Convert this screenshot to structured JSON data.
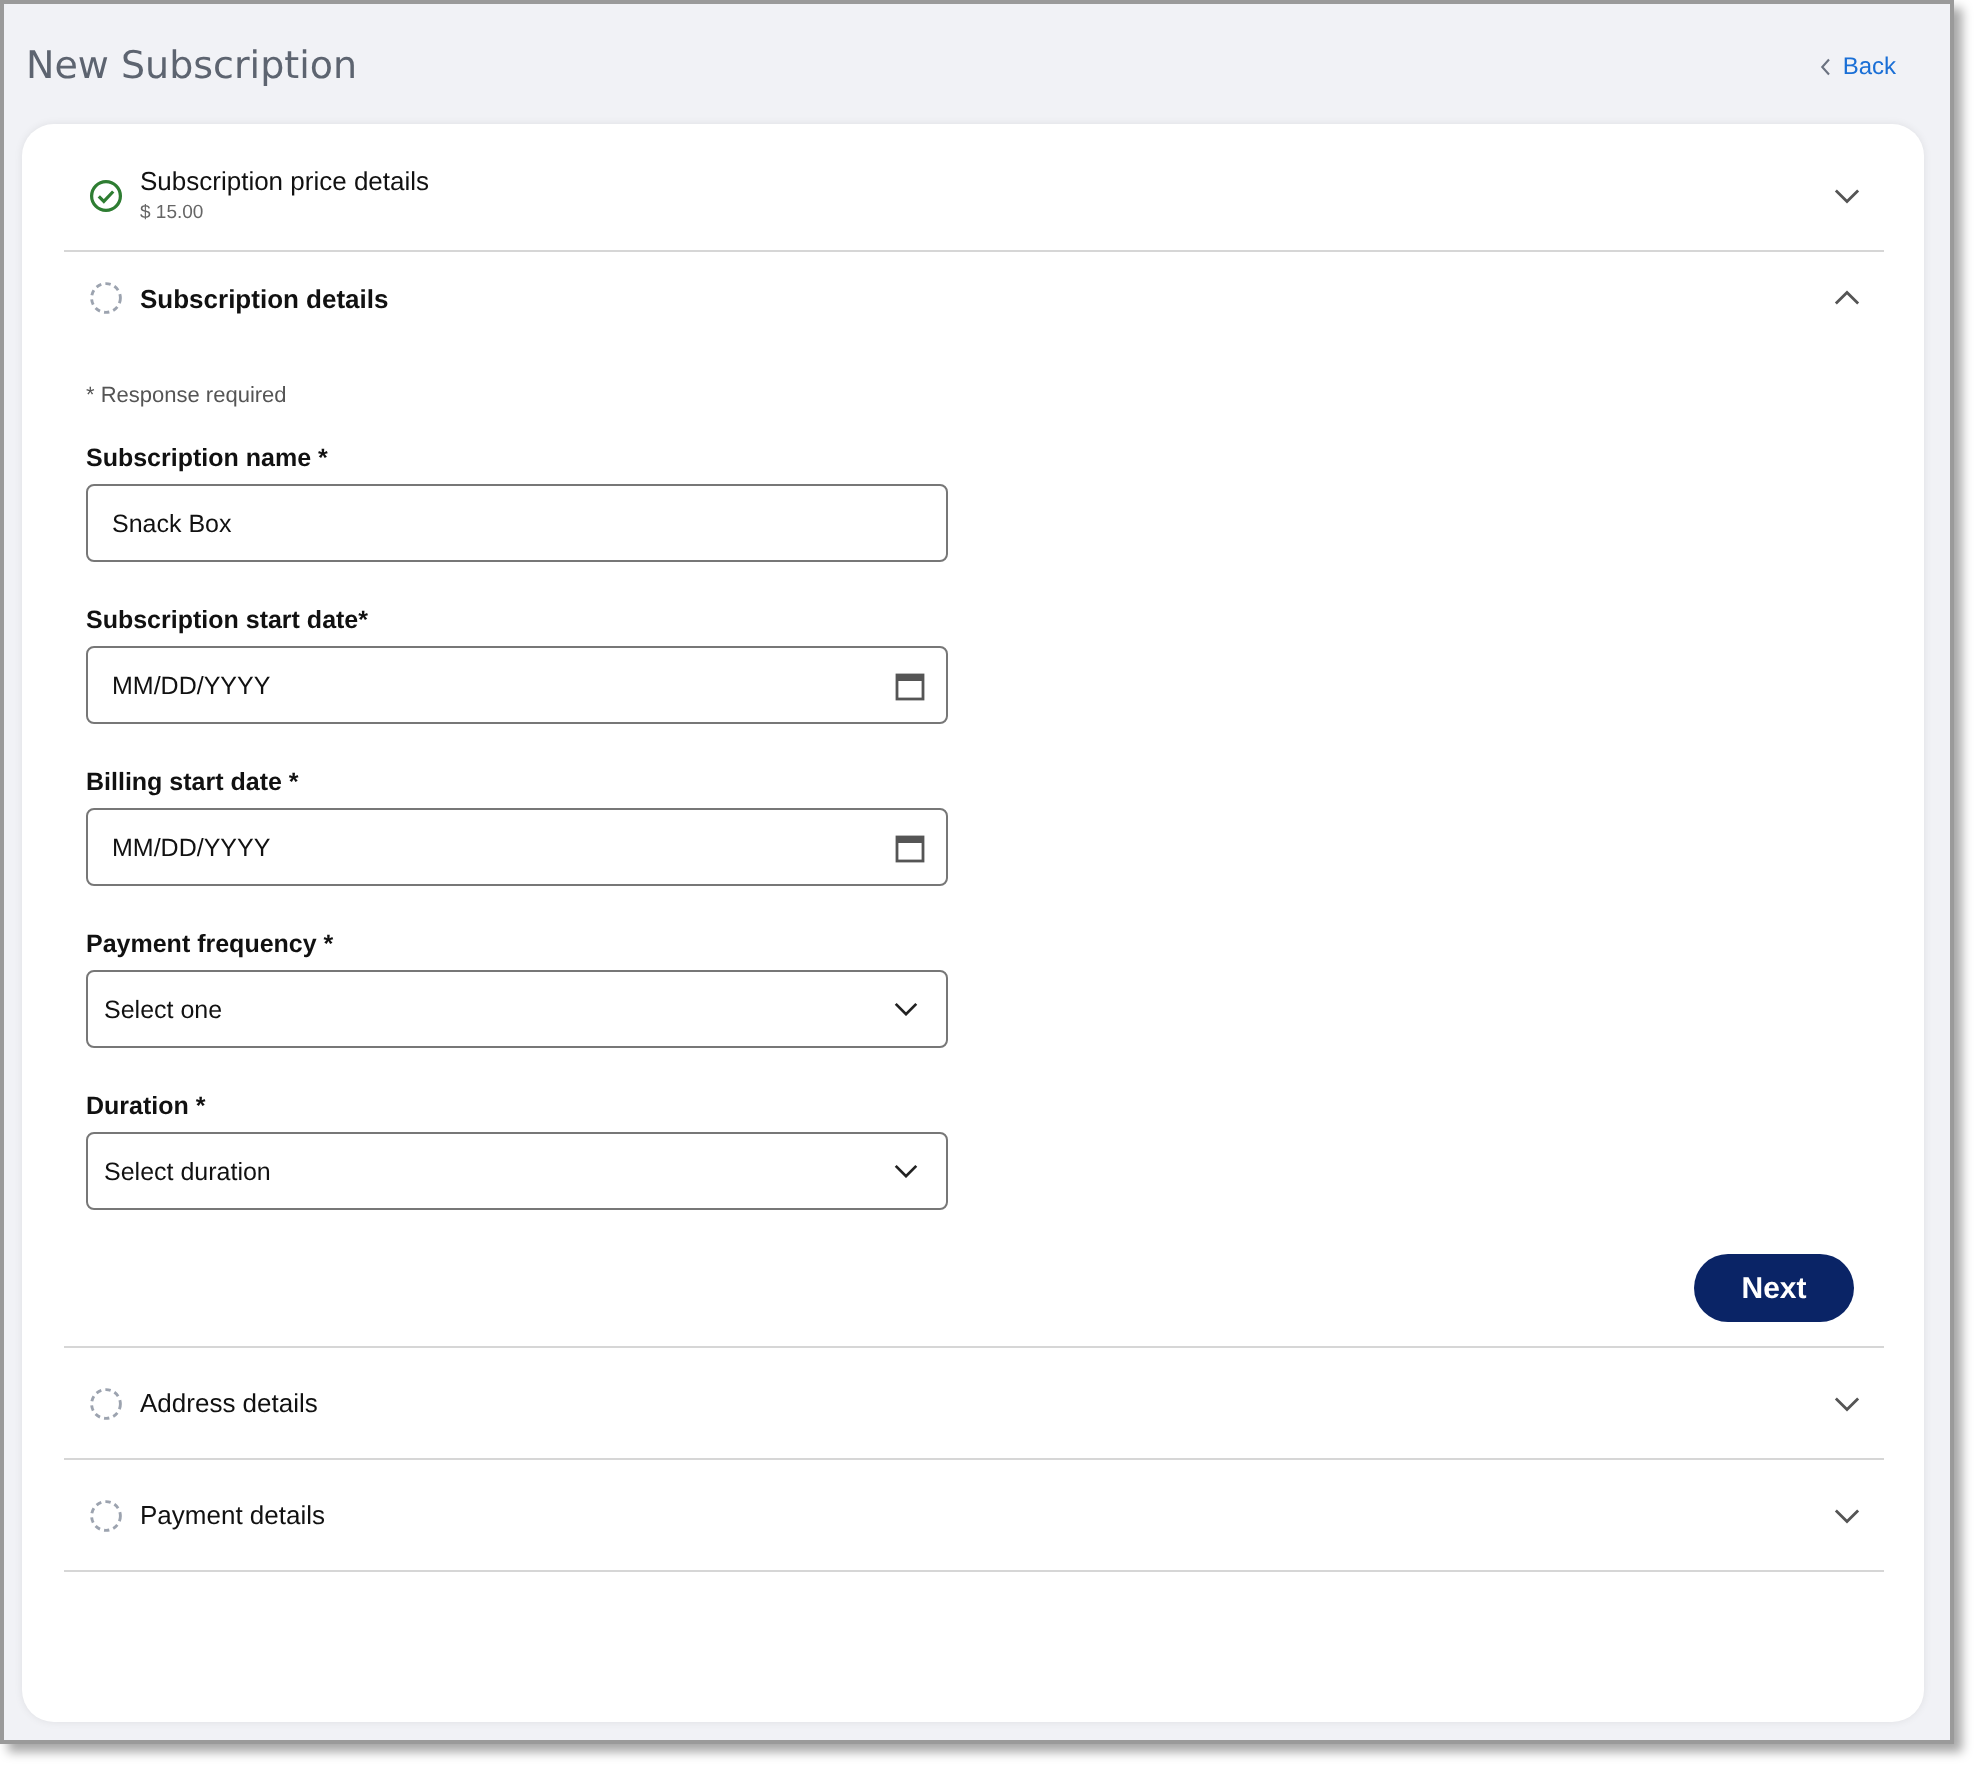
{
  "page": {
    "title": "New Subscription",
    "back_link": "Back"
  },
  "sections": [
    {
      "title": "Subscription price details",
      "subtitle": "$ 15.00",
      "completed": true,
      "expanded": false
    },
    {
      "title": "Subscription details",
      "completed": false,
      "expanded": true,
      "form": {
        "required_note": "* Response required",
        "fields": [
          {
            "kind": "text",
            "label": "Subscription name *",
            "value": "Snack Box"
          },
          {
            "kind": "date",
            "label": "Subscription start date*",
            "placeholder": "MM/DD/YYYY"
          },
          {
            "kind": "date",
            "label": "Billing start date *",
            "placeholder": "MM/DD/YYYY"
          },
          {
            "kind": "select",
            "label": "Payment frequency *",
            "value": "Select one"
          },
          {
            "kind": "select",
            "label": "Duration *",
            "value": "Select duration"
          }
        ],
        "next_button": "Next"
      }
    },
    {
      "title": "Address details",
      "completed": false,
      "expanded": false
    },
    {
      "title": "Payment details",
      "completed": false,
      "expanded": false
    }
  ]
}
